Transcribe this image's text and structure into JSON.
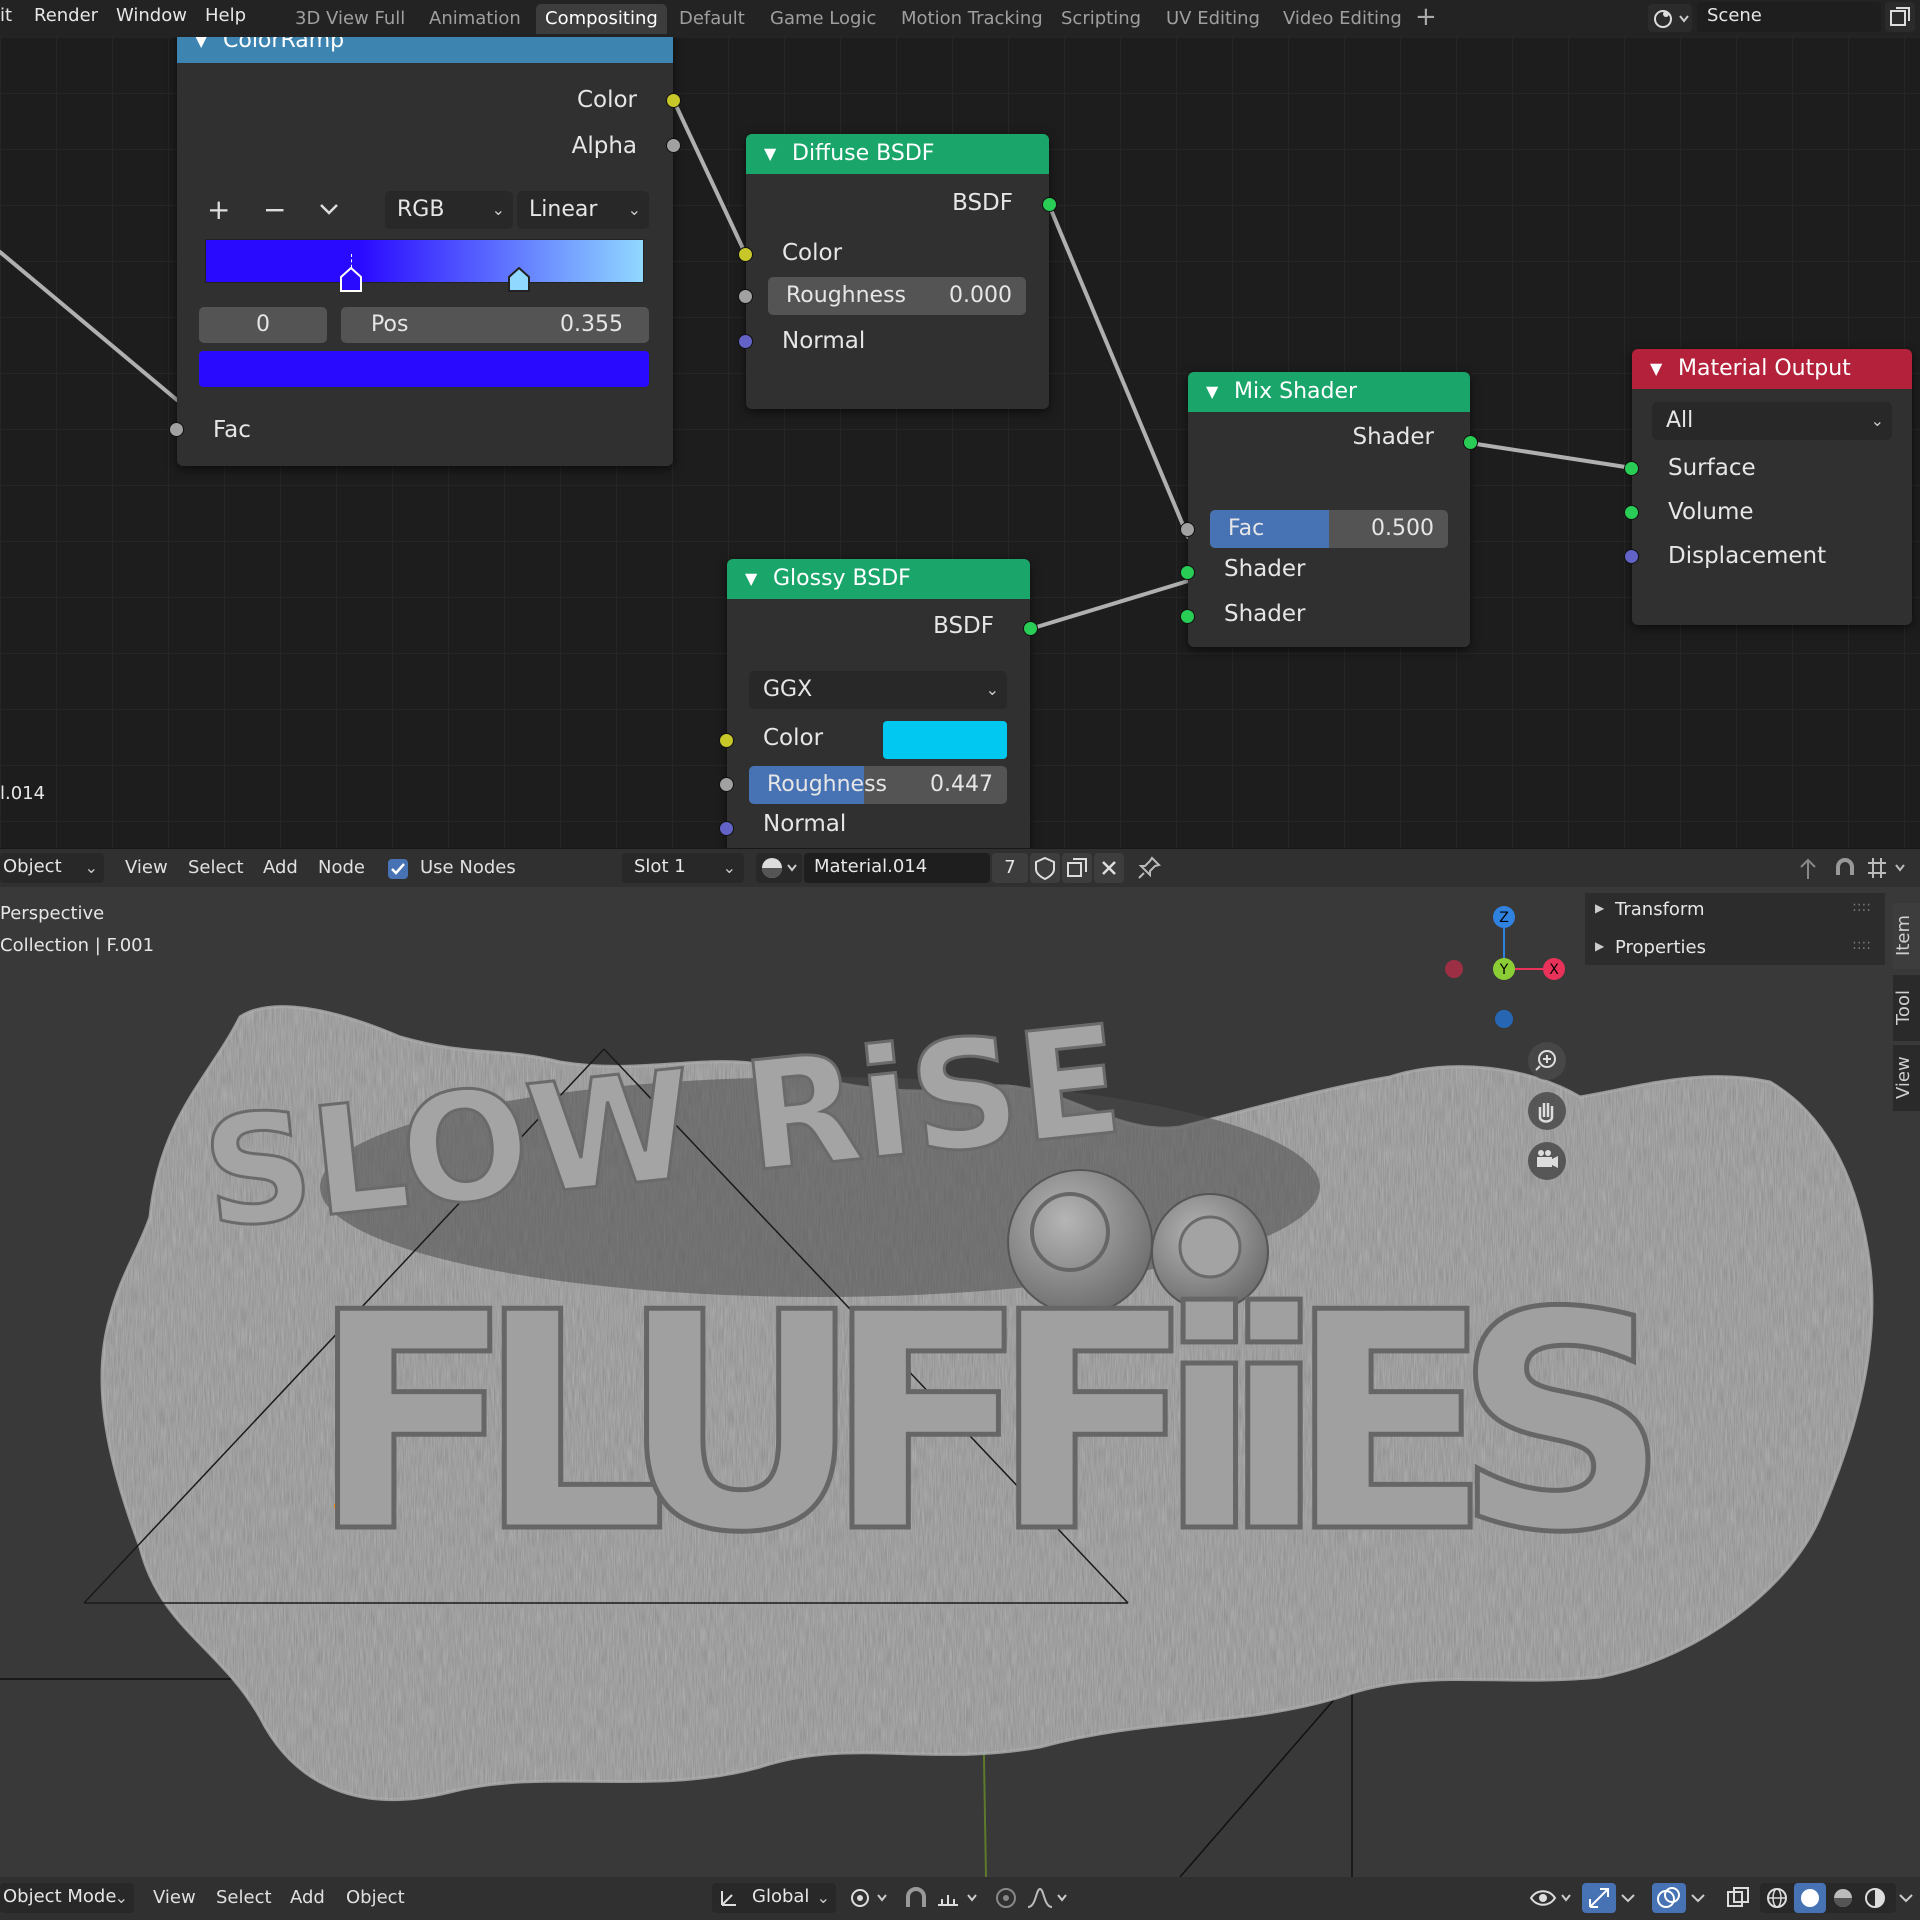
{
  "topbar": {
    "menus": [
      "it",
      "Render",
      "Window",
      "Help"
    ],
    "workspaces": [
      "3D View Full",
      "Animation",
      "Compositing",
      "Default",
      "Game Logic",
      "Motion Tracking",
      "Scripting",
      "UV Editing",
      "Video Editing"
    ],
    "active_workspace": "Compositing",
    "scene": "Scene"
  },
  "nodes": {
    "colorramp": {
      "title": "ColorRamp",
      "out_color": "Color",
      "out_alpha": "Alpha",
      "color_mode": "RGB",
      "interpolation": "Linear",
      "stop_index": "0",
      "pos_label": "Pos",
      "pos_value": "0.355",
      "in_fac": "Fac",
      "gradient_start": "#2a0aff",
      "gradient_end": "#90d8ff"
    },
    "diffuse": {
      "title": "Diffuse BSDF",
      "out": "BSDF",
      "in_color": "Color",
      "roughness_label": "Roughness",
      "roughness_value": "0.000",
      "in_normal": "Normal"
    },
    "mix": {
      "title": "Mix Shader",
      "out": "Shader",
      "fac_label": "Fac",
      "fac_value": "0.500",
      "in_shader1": "Shader",
      "in_shader2": "Shader"
    },
    "glossy": {
      "title": "Glossy BSDF",
      "out": "BSDF",
      "distribution": "GGX",
      "in_color": "Color",
      "color_value": "#00c8f0",
      "roughness_label": "Roughness",
      "roughness_value": "0.447",
      "in_normal": "Normal"
    },
    "output": {
      "title": "Material Output",
      "target": "All",
      "in_surface": "Surface",
      "in_volume": "Volume",
      "in_displacement": "Displacement"
    }
  },
  "material_name_fragment": "l.014",
  "node_header": {
    "mode": "Object",
    "menus": [
      "View",
      "Select",
      "Add",
      "Node"
    ],
    "use_nodes_label": "Use Nodes",
    "use_nodes_checked": true,
    "slot": "Slot 1",
    "material": "Material.014",
    "users": "7"
  },
  "viewport": {
    "view_label": "Perspective",
    "collection_label": "Collection | F.001",
    "gizmo_z": "Z",
    "gizmo_y": "Y",
    "gizmo_x": "X",
    "npanel_items": [
      "Transform",
      "Properties"
    ],
    "side_tabs": [
      "Item",
      "Tool",
      "View"
    ],
    "logo_line1": "SLOW RiSE",
    "logo_line2": "FLUFFiiES"
  },
  "footer": {
    "mode": "Object Mode",
    "menus": [
      "View",
      "Select",
      "Add",
      "Object"
    ],
    "orientation": "Global"
  },
  "colors": {
    "shader_header": "#1aa66a",
    "output_header": "#b3213a",
    "colorramp_header": "#3d85b0",
    "accent_blue": "#4772b3"
  }
}
